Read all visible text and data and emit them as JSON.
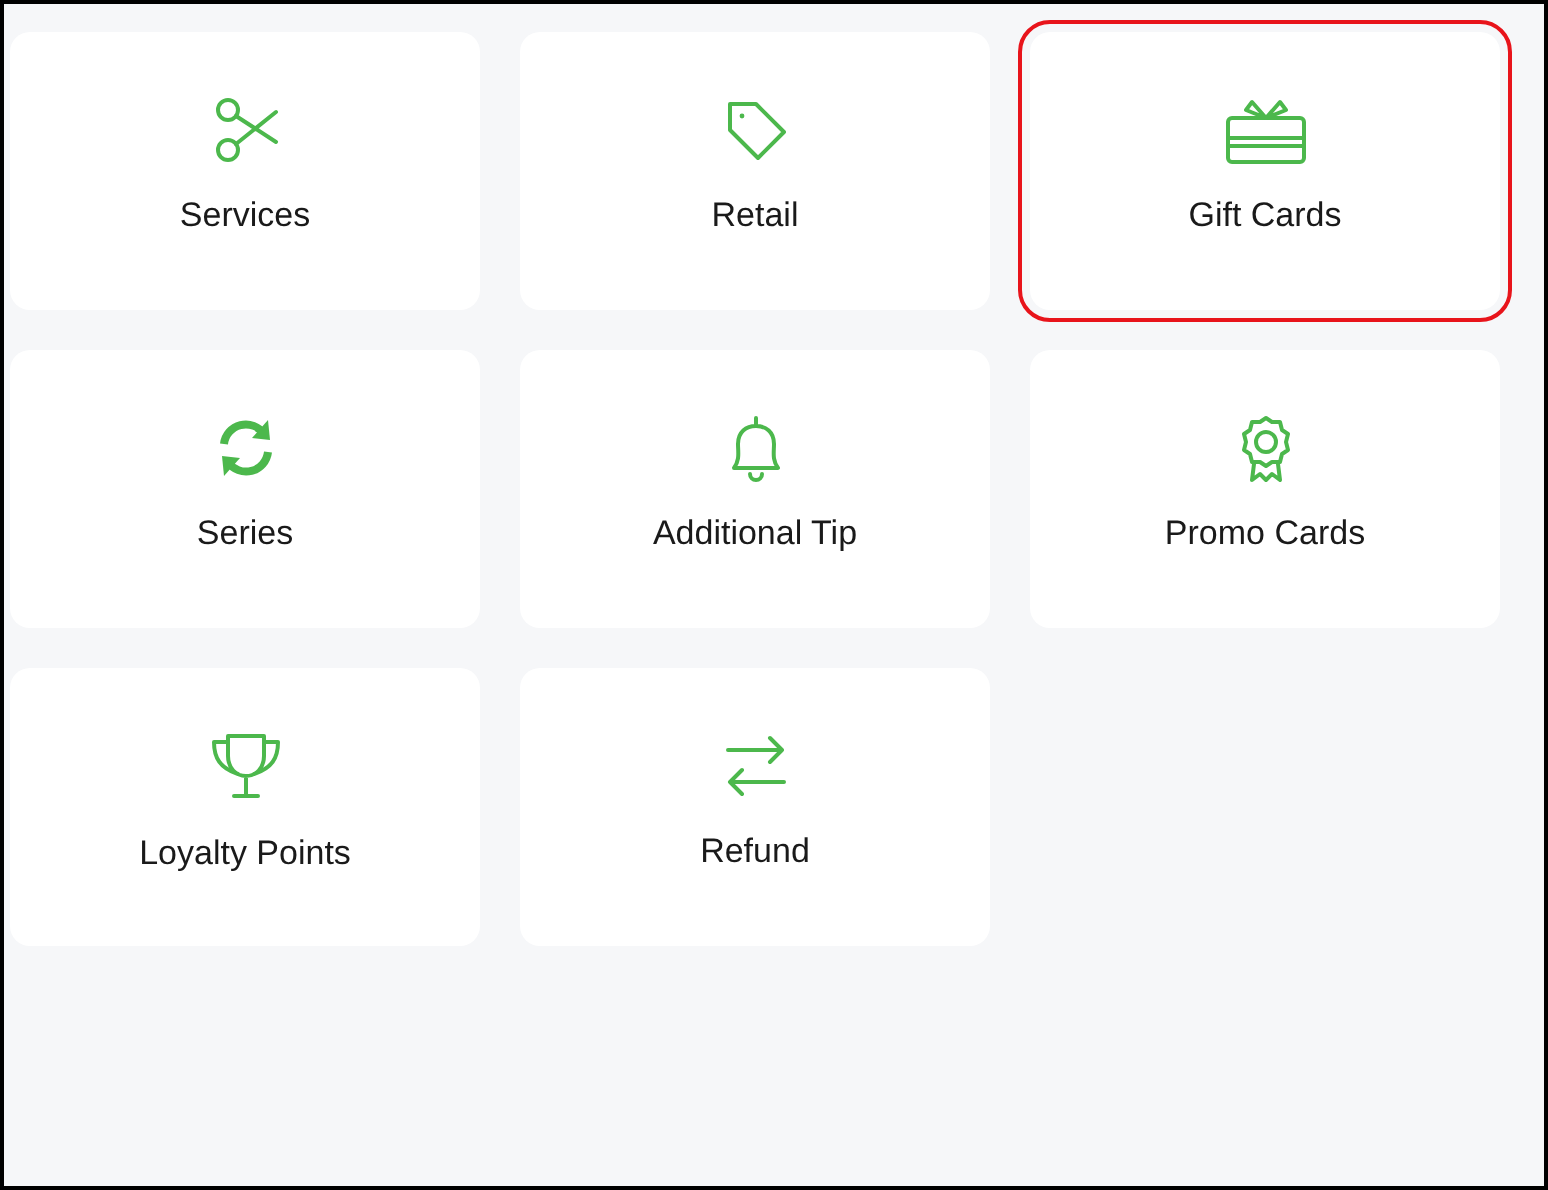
{
  "tiles": [
    {
      "label": "Services",
      "highlighted": false
    },
    {
      "label": "Retail",
      "highlighted": false
    },
    {
      "label": "Gift Cards",
      "highlighted": true
    },
    {
      "label": "Series",
      "highlighted": false
    },
    {
      "label": "Additional Tip",
      "highlighted": false
    },
    {
      "label": "Promo Cards",
      "highlighted": false
    },
    {
      "label": "Loyalty Points",
      "highlighted": false
    },
    {
      "label": "Refund",
      "highlighted": false
    }
  ]
}
